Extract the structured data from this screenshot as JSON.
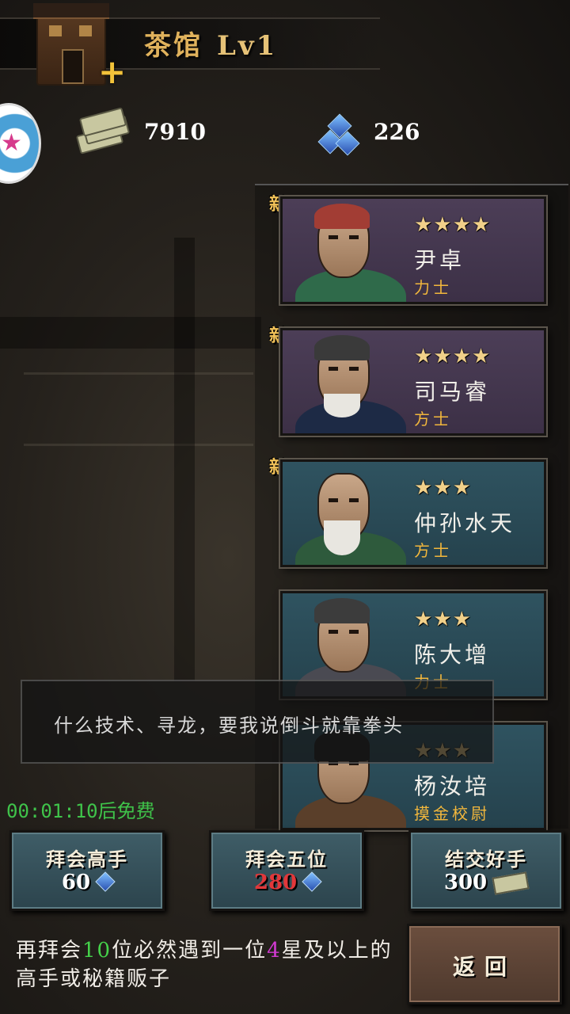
{
  "header": {
    "title": "茶馆",
    "level": "Lv1"
  },
  "resources": {
    "money": "7910",
    "gems": "226"
  },
  "heroes": [
    {
      "new": "新",
      "stars": "★★★★",
      "name": "尹卓",
      "role": "力士"
    },
    {
      "new": "新",
      "stars": "★★★★",
      "name": "司马睿",
      "role": "方士"
    },
    {
      "new": "新",
      "stars": "★★★",
      "name": "仲孙水天",
      "role": "方士"
    },
    {
      "stars": "★★★",
      "name": "陈大增",
      "role": "力士"
    },
    {
      "stars": "★★★",
      "name": "杨汝培",
      "role": "摸金校尉"
    }
  ],
  "dialogue": "什么技术、寻龙，要我说倒斗就靠拳头",
  "timer": "00:01:10后免费",
  "buttons": [
    {
      "label": "拜会高手",
      "cost": "60",
      "currency": "gem-icon"
    },
    {
      "label": "拜会五位",
      "cost": "280",
      "currency": "gem-icon",
      "cost_color": "#e2373a"
    },
    {
      "label": "结交好手",
      "cost": "300",
      "currency": "money-icon"
    }
  ],
  "hint": {
    "part1": "再拜会",
    "num1": "10",
    "part2": "位必然遇到一位",
    "num2": "4",
    "part3": "星及以上的高手或秘籍贩子"
  },
  "back_label": "返回",
  "colors": {
    "gold": "#e0b25c",
    "timer_green": "#3fc34a",
    "card_purple": "#4c3e57",
    "card_teal": "#2f5360"
  }
}
